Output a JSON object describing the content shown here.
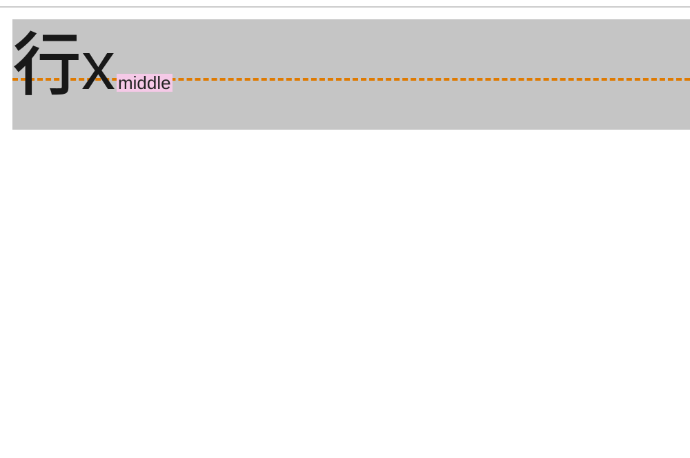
{
  "diagram": {
    "big_cjk": "行",
    "big_x": "x",
    "label": "middle",
    "colors": {
      "box_bg": "#c5c5c5",
      "dashed": "#e07a00",
      "label_bg": "#f5c9e7"
    },
    "alignment": "middle"
  }
}
